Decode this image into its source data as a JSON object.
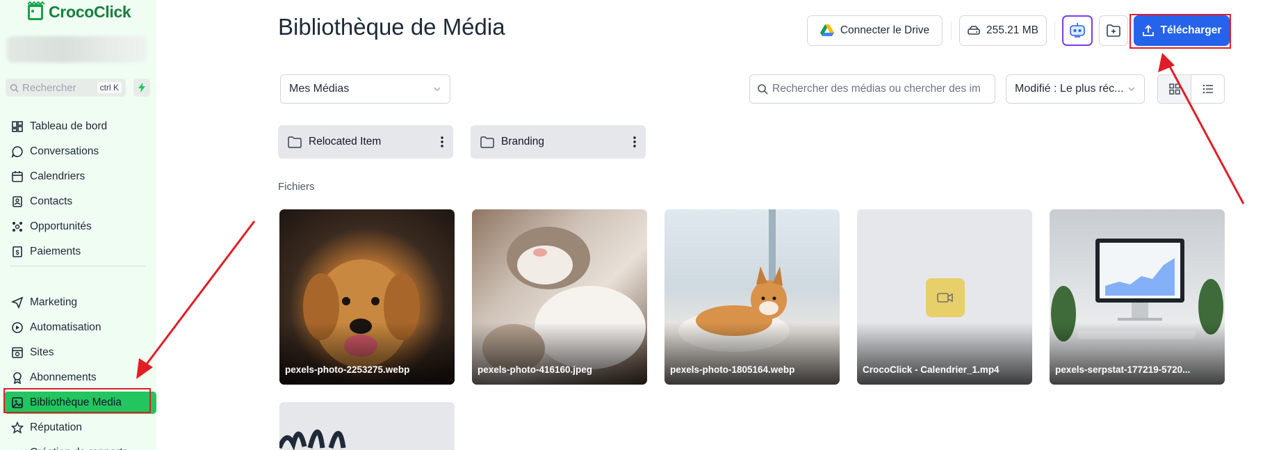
{
  "brand": {
    "name_prefix": "Croco",
    "name_suffix": "Click"
  },
  "sidebar": {
    "search": {
      "placeholder": "Rechercher",
      "shortcut": "ctrl K"
    },
    "items": [
      {
        "label": "Tableau de bord",
        "icon": "dashboard-icon"
      },
      {
        "label": "Conversations",
        "icon": "chat-icon"
      },
      {
        "label": "Calendriers",
        "icon": "calendar-icon"
      },
      {
        "label": "Contacts",
        "icon": "contacts-icon"
      },
      {
        "label": "Opportunités",
        "icon": "opportunities-icon"
      },
      {
        "label": "Paiements",
        "icon": "payments-icon"
      },
      {
        "label": "Marketing",
        "icon": "send-icon"
      },
      {
        "label": "Automatisation",
        "icon": "automation-icon"
      },
      {
        "label": "Sites",
        "icon": "sites-icon"
      },
      {
        "label": "Abonnements",
        "icon": "badge-icon"
      },
      {
        "label": "Bibliothèque Media",
        "icon": "image-icon",
        "active": true
      },
      {
        "label": "Réputation",
        "icon": "star-icon"
      },
      {
        "label": "Création de rapports",
        "icon": "reports-icon"
      }
    ]
  },
  "page": {
    "title": "Bibliothèque de Média"
  },
  "toolbar": {
    "drive_label": "Connecter le Drive",
    "storage_label": "255.21 MB",
    "upload_label": "Télécharger"
  },
  "filters": {
    "scope_value": "Mes Médias",
    "search_placeholder": "Rechercher des médias ou chercher des im",
    "sort_value": "Modifié : Le plus réc..."
  },
  "folders": [
    {
      "name": "Relocated Item"
    },
    {
      "name": "Branding"
    }
  ],
  "files_section_label": "Fichiers",
  "files": [
    {
      "name": "pexels-photo-2253275.webp",
      "kind": "image"
    },
    {
      "name": "pexels-photo-416160.jpeg",
      "kind": "image"
    },
    {
      "name": "pexels-photo-1805164.webp",
      "kind": "image"
    },
    {
      "name": "CrocoClick - Calendrier_1.mp4",
      "kind": "video"
    },
    {
      "name": "pexels-serpstat-177219-5720...",
      "kind": "image"
    }
  ],
  "colors": {
    "accent": "#2563eb",
    "sidebar_bg": "#f0fdf3",
    "active_item": "#22c55e",
    "annotation": "#e11d25"
  }
}
